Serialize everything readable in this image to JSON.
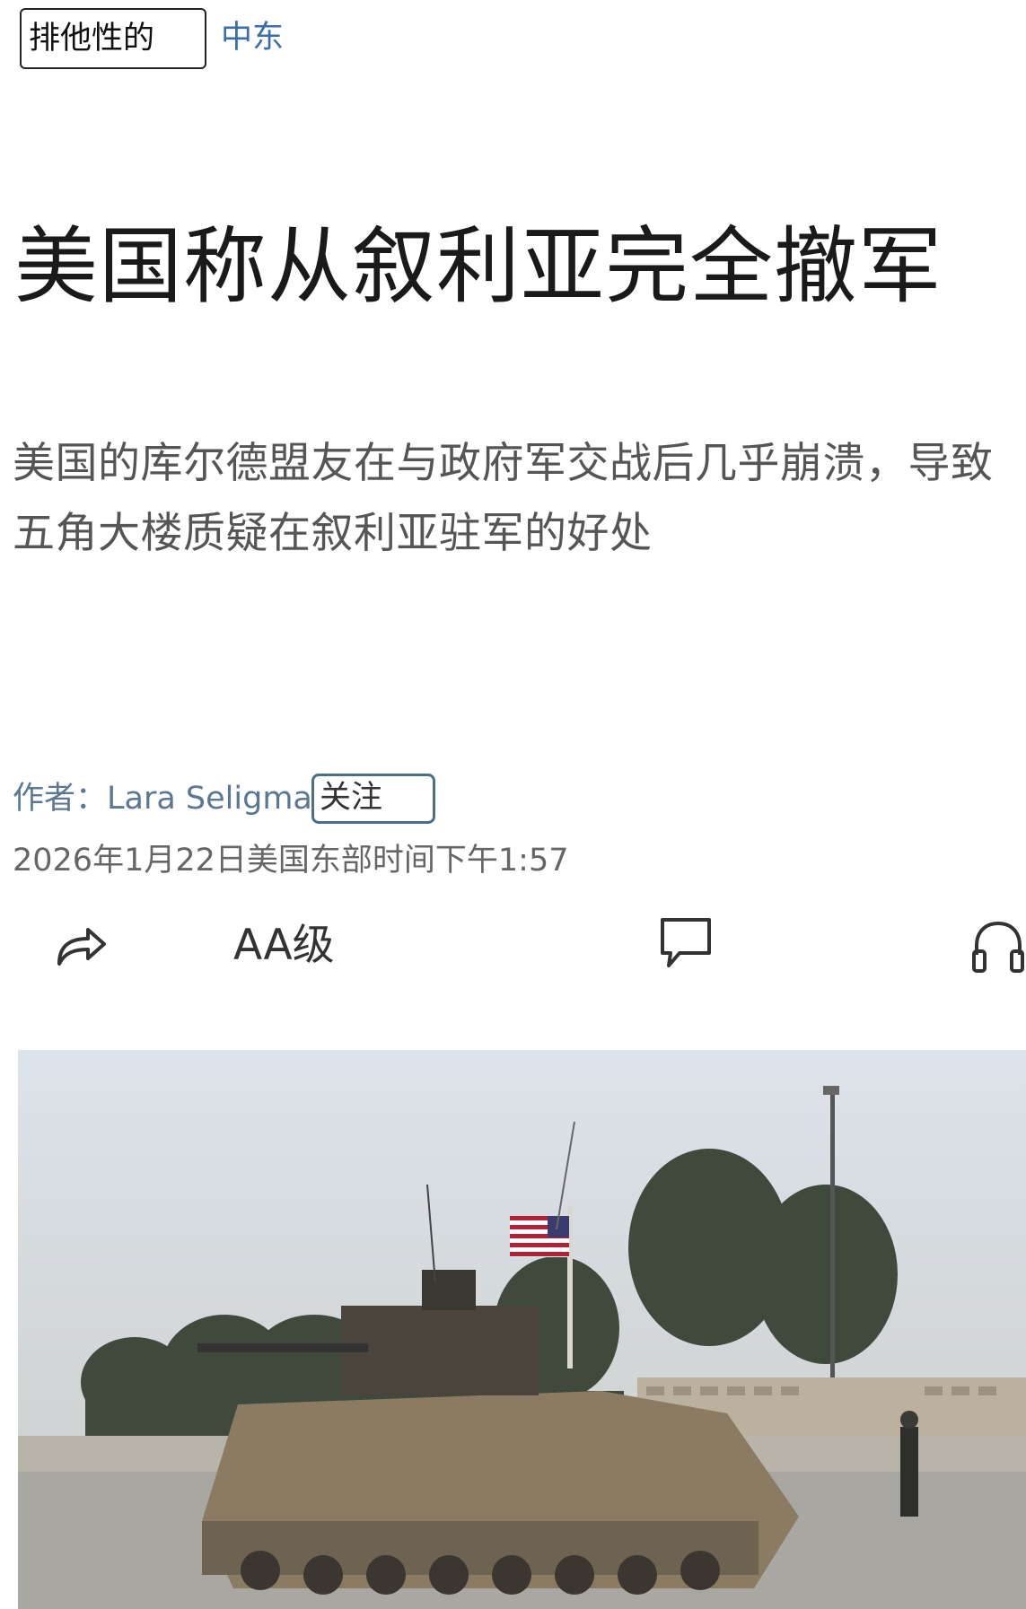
{
  "topbar": {
    "tag_label": "排他性的",
    "section_label": "中东"
  },
  "article": {
    "headline": "美国称从叙利亚完全撤军",
    "subtitle": "美国的库尔德盟友在与政府军交战后几乎崩溃，导致五角大楼质疑在叙利亚驻军的好处",
    "author_prefix": "作者：",
    "author_name": "Lara Seligman",
    "follow_label": "关注",
    "timestamp": "2026年1月22日美国东部时间下午1:57"
  },
  "toolbar": {
    "font_size_label": "AA级",
    "icons": [
      "share-icon",
      "comment-icon",
      "headphones-icon"
    ]
  },
  "photo": {
    "subject": "armored-vehicle-with-us-flag-image"
  },
  "colors": {
    "link": "#3b6ea5",
    "author": "#5b7793",
    "follow_border": "#4b6f86",
    "headline": "#1a1a1a"
  }
}
